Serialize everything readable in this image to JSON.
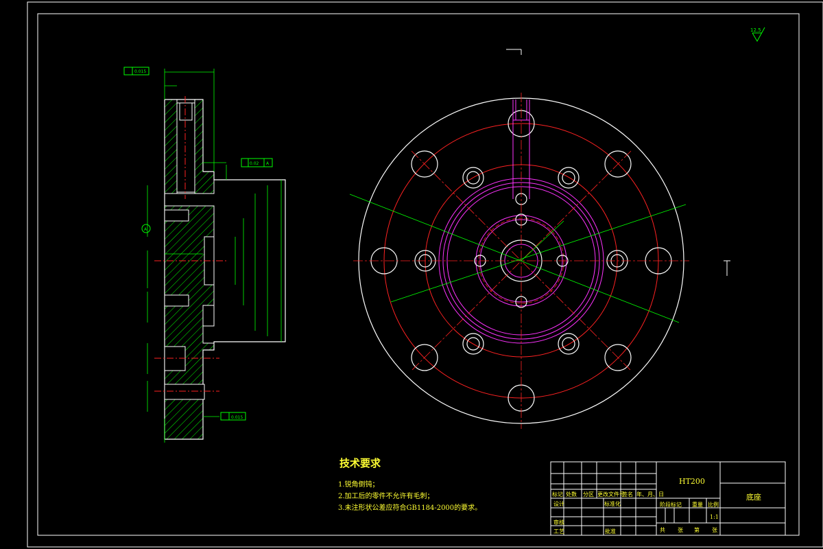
{
  "technical_requirements": {
    "title": "技术要求",
    "items": [
      "1.锐角倒钝；",
      "2.加工后的零件不允许有毛刺；",
      "3.未注形状公差应符合GB1184-2000的要求。"
    ]
  },
  "title_block": {
    "material": "HT200",
    "part_name": "底座",
    "scale": "1:1",
    "header_labels": [
      "标记",
      "处数",
      "分区",
      "更改文件号",
      "签名",
      "年、月、日"
    ],
    "row_labels": [
      "设计",
      "审核",
      "工艺"
    ],
    "standardization": "标准化",
    "approval": "批准",
    "stage_mark": "阶段标记",
    "weight": "重量",
    "scale_label": "比例",
    "sheet_info": [
      "共",
      "张",
      "第",
      "张"
    ]
  },
  "annotations": {
    "roughness_corner": "12.5",
    "flatness_1": "0.015",
    "flatness_2": "0.015",
    "parallelism": "0.02",
    "datum": "A"
  },
  "colors": {
    "frame": "#ffffff",
    "outline": "#ffffff",
    "dimension": "#00ff00",
    "centerline": "#ff2222",
    "hatch": "#00ff00",
    "magenta": "#ff33ff",
    "text": "#ffff33"
  }
}
